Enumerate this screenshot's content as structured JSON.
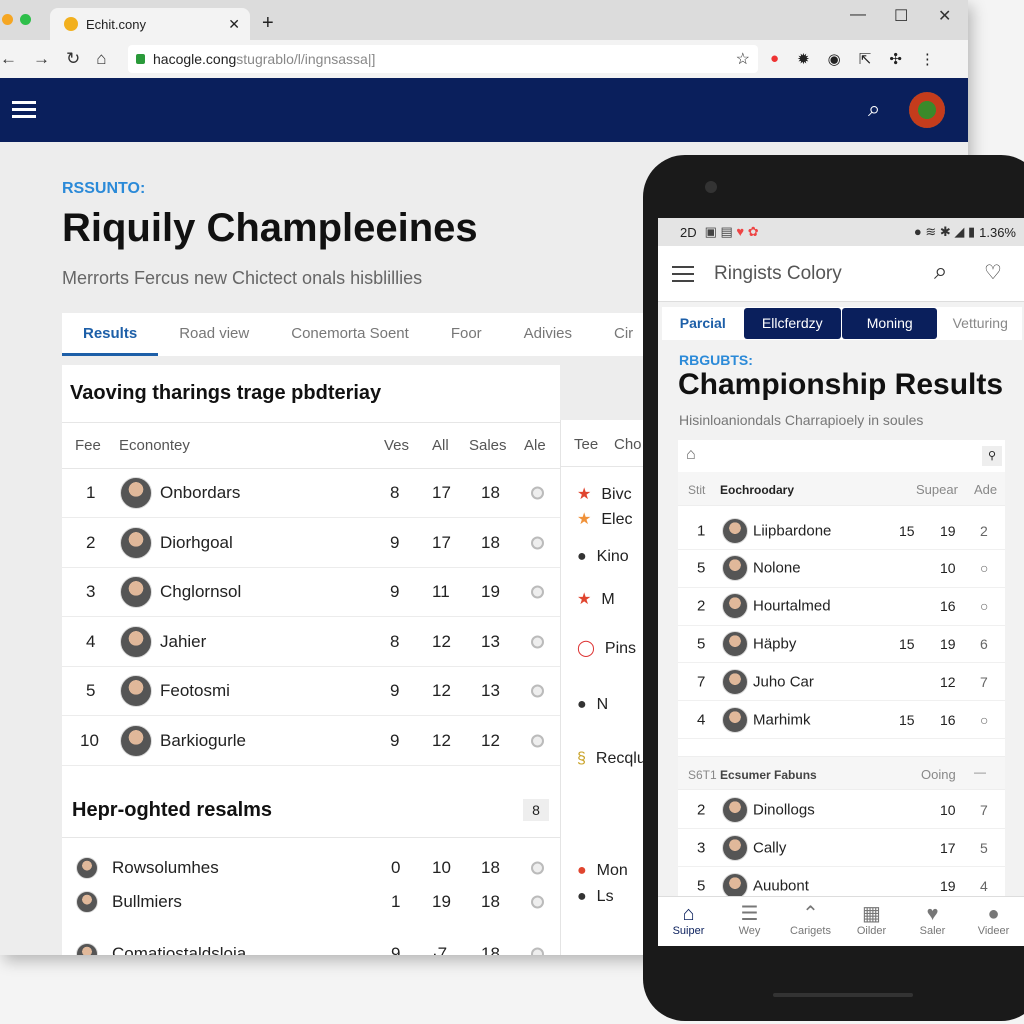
{
  "browser": {
    "tab_title": "Echit.cony",
    "url_host": "hacogle.cong",
    "url_path": "stugrablo/l/ingnsassa|]"
  },
  "page": {
    "kicker": "RSSUNTO:",
    "title": "Riquily Champleeines",
    "subtitle": "Merrorts Fercus new Chictect onals hisblillies",
    "tabs": [
      "Results",
      "Road view",
      "Conemorta Soent",
      "Foor",
      "Adivies",
      "Cir"
    ]
  },
  "table": {
    "section_title": "Vaoving tharings trage pbdteriay",
    "headers": [
      "Fee",
      "Econontey",
      "Ves",
      "All",
      "Sales",
      "Ale"
    ],
    "rows": [
      [
        "1",
        "Onbordars",
        "8",
        "17",
        "18"
      ],
      [
        "2",
        "Diorhgoal",
        "9",
        "17",
        "18"
      ],
      [
        "3",
        "Chglornsol",
        "9",
        "11",
        "19"
      ],
      [
        "4",
        "Jahier",
        "8",
        "12",
        "13"
      ],
      [
        "5",
        "Feotosmi",
        "9",
        "12",
        "13"
      ],
      [
        "10",
        "Barkiogurle",
        "9",
        "12",
        "12"
      ]
    ],
    "section2_title": "Hepr-oghted resalms",
    "section2_badge": "8",
    "rows2": [
      [
        "Rowsolumhes",
        "0",
        "10",
        "18"
      ],
      [
        "Bullmiers",
        "1",
        "19",
        "18"
      ],
      [
        "Comatiostaldsloia",
        "9",
        "·7",
        "18"
      ]
    ]
  },
  "side": {
    "headers": [
      "Tee",
      "Cho"
    ],
    "items": [
      [
        "★",
        "Bivc",
        "#e0452f"
      ],
      [
        "★",
        "Elec",
        "#f0923a"
      ],
      [
        "●",
        "Kino",
        "#333"
      ],
      [
        "★",
        "M",
        "#e0452f"
      ],
      [
        "◯",
        "Pins",
        "#d33"
      ],
      [
        "●",
        "N",
        "#333"
      ],
      [
        "§",
        "Recqlu",
        "#c9a227"
      ],
      [
        "●",
        "Mon",
        "#e0452f"
      ],
      [
        "●",
        "Ls",
        "#333"
      ]
    ]
  },
  "phone": {
    "status_left": "2D",
    "battery": "1.36%",
    "app_title": "Ringists Colory",
    "tabs": [
      "Parcial",
      "Ellcferdzy",
      "Moning",
      "Vetturing"
    ],
    "kicker": "RBGUBTS:",
    "title": "Championship Results",
    "subtitle": "Hisinloaniondals Charrapioely in soules",
    "headers": [
      "Stit",
      "Eochroodary",
      "Supear",
      "Ade"
    ],
    "rows": [
      [
        "1",
        "Liipbardone",
        "15",
        "19",
        "2"
      ],
      [
        "5",
        "Nolone",
        "",
        "10",
        "○"
      ],
      [
        "2",
        "Hourtalmed",
        "",
        "16",
        "○"
      ],
      [
        "5",
        "Häpby",
        "15",
        "19",
        "6"
      ],
      [
        "7",
        "Juho Car",
        "",
        "12",
        "7"
      ],
      [
        "4",
        "Marhimk",
        "15",
        "16",
        "○"
      ]
    ],
    "section2": [
      "S6T1",
      "Ecsumer Fabuns",
      "Ooing"
    ],
    "rows2": [
      [
        "2",
        "Dinollogs",
        "",
        "10",
        "7"
      ],
      [
        "3",
        "Cally",
        "",
        "17",
        "5"
      ],
      [
        "5",
        "Auubont",
        "",
        "19",
        "4"
      ]
    ],
    "nav": [
      "Suiper",
      "Wey",
      "Carigets",
      "Oilder",
      "Saler",
      "Videer"
    ]
  },
  "colors": {
    "navy": "#0a1f5c",
    "accent": "#1d5fa8",
    "kicker": "#2b8ad8"
  }
}
